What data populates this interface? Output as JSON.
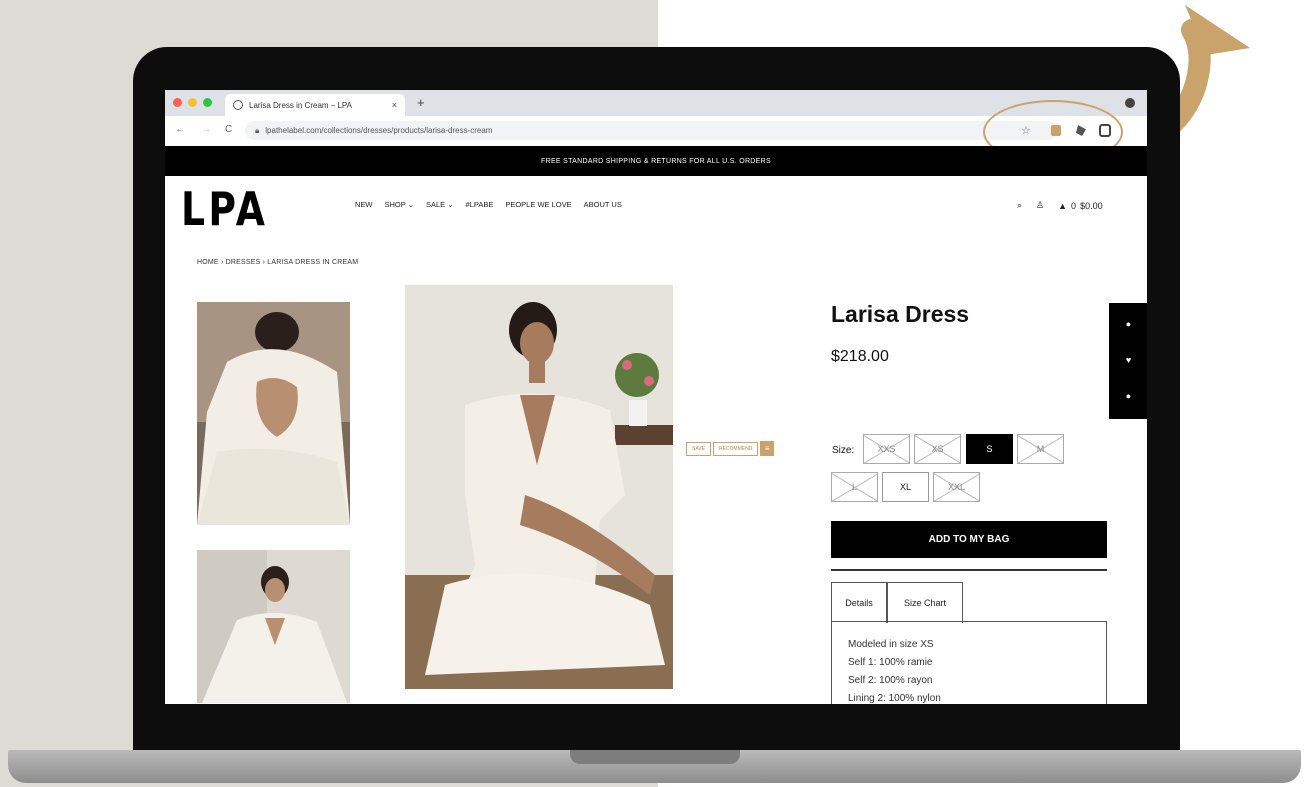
{
  "browser": {
    "tab_title": "Larisa Dress in Cream – LPA",
    "tab_close": "×",
    "new_tab": "+",
    "url": "lpathelabel.com/collections/dresses/products/larisa-dress-cream",
    "nav_back": "←",
    "nav_forward": "→",
    "nav_reload": "C"
  },
  "site": {
    "announcement": "FREE STANDARD SHIPPING & RETURNS FOR ALL U.S. ORDERS",
    "logo": "LPA",
    "nav": [
      "NEW",
      "SHOP ⌄",
      "SALE ⌄",
      "#LPABE",
      "PEOPLE WE LOVE",
      "ABOUT US"
    ],
    "cart_count": "0",
    "cart_total": "$0.00",
    "breadcrumb": "HOME  ›  DRESSES  ›  LARISA DRESS IN CREAM"
  },
  "product": {
    "title": "Larisa Dress",
    "price": "$218.00",
    "size_label": "Size:",
    "sizes": [
      {
        "label": "XXS",
        "state": "sold"
      },
      {
        "label": "XS",
        "state": "sold"
      },
      {
        "label": "S",
        "state": "selected"
      },
      {
        "label": "M",
        "state": "sold"
      },
      {
        "label": "L",
        "state": "sold"
      },
      {
        "label": "XL",
        "state": "available"
      },
      {
        "label": "XXL",
        "state": "sold"
      }
    ],
    "add_to_bag": "ADD TO MY BAG",
    "tabs": [
      "Details",
      "Size Chart"
    ],
    "details": [
      "Modeled in size XS",
      "Self 1: 100% ramie",
      "Self 2: 100% rayon",
      "Lining 2: 100% nylon"
    ]
  },
  "image_tags": {
    "tag1": "SAVE",
    "tag2": "RECOMMEND",
    "tag3": "≡"
  },
  "colors": {
    "accent_gold": "#c9a36a",
    "black": "#000000"
  }
}
